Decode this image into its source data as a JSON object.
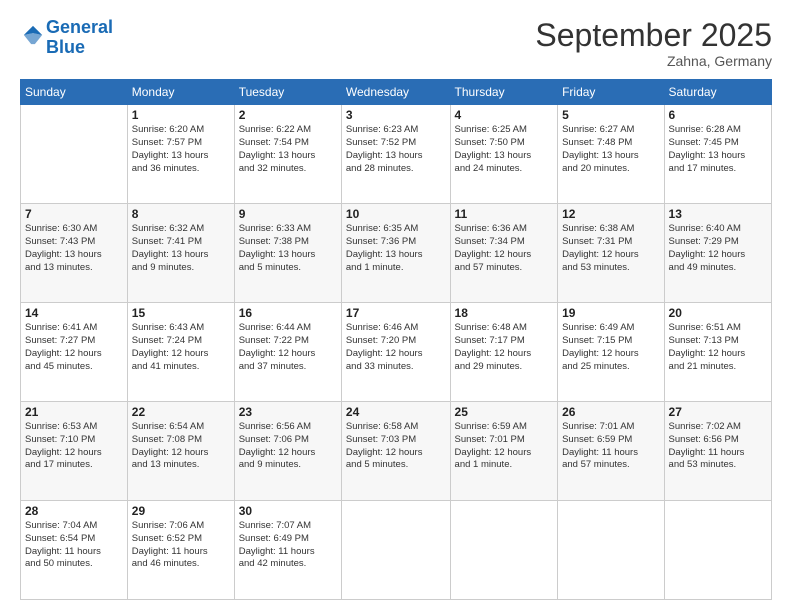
{
  "header": {
    "logo_line1": "General",
    "logo_line2": "Blue",
    "month": "September 2025",
    "location": "Zahna, Germany"
  },
  "days_of_week": [
    "Sunday",
    "Monday",
    "Tuesday",
    "Wednesday",
    "Thursday",
    "Friday",
    "Saturday"
  ],
  "weeks": [
    [
      {
        "day": "",
        "info": ""
      },
      {
        "day": "1",
        "info": "Sunrise: 6:20 AM\nSunset: 7:57 PM\nDaylight: 13 hours\nand 36 minutes."
      },
      {
        "day": "2",
        "info": "Sunrise: 6:22 AM\nSunset: 7:54 PM\nDaylight: 13 hours\nand 32 minutes."
      },
      {
        "day": "3",
        "info": "Sunrise: 6:23 AM\nSunset: 7:52 PM\nDaylight: 13 hours\nand 28 minutes."
      },
      {
        "day": "4",
        "info": "Sunrise: 6:25 AM\nSunset: 7:50 PM\nDaylight: 13 hours\nand 24 minutes."
      },
      {
        "day": "5",
        "info": "Sunrise: 6:27 AM\nSunset: 7:48 PM\nDaylight: 13 hours\nand 20 minutes."
      },
      {
        "day": "6",
        "info": "Sunrise: 6:28 AM\nSunset: 7:45 PM\nDaylight: 13 hours\nand 17 minutes."
      }
    ],
    [
      {
        "day": "7",
        "info": "Sunrise: 6:30 AM\nSunset: 7:43 PM\nDaylight: 13 hours\nand 13 minutes."
      },
      {
        "day": "8",
        "info": "Sunrise: 6:32 AM\nSunset: 7:41 PM\nDaylight: 13 hours\nand 9 minutes."
      },
      {
        "day": "9",
        "info": "Sunrise: 6:33 AM\nSunset: 7:38 PM\nDaylight: 13 hours\nand 5 minutes."
      },
      {
        "day": "10",
        "info": "Sunrise: 6:35 AM\nSunset: 7:36 PM\nDaylight: 13 hours\nand 1 minute."
      },
      {
        "day": "11",
        "info": "Sunrise: 6:36 AM\nSunset: 7:34 PM\nDaylight: 12 hours\nand 57 minutes."
      },
      {
        "day": "12",
        "info": "Sunrise: 6:38 AM\nSunset: 7:31 PM\nDaylight: 12 hours\nand 53 minutes."
      },
      {
        "day": "13",
        "info": "Sunrise: 6:40 AM\nSunset: 7:29 PM\nDaylight: 12 hours\nand 49 minutes."
      }
    ],
    [
      {
        "day": "14",
        "info": "Sunrise: 6:41 AM\nSunset: 7:27 PM\nDaylight: 12 hours\nand 45 minutes."
      },
      {
        "day": "15",
        "info": "Sunrise: 6:43 AM\nSunset: 7:24 PM\nDaylight: 12 hours\nand 41 minutes."
      },
      {
        "day": "16",
        "info": "Sunrise: 6:44 AM\nSunset: 7:22 PM\nDaylight: 12 hours\nand 37 minutes."
      },
      {
        "day": "17",
        "info": "Sunrise: 6:46 AM\nSunset: 7:20 PM\nDaylight: 12 hours\nand 33 minutes."
      },
      {
        "day": "18",
        "info": "Sunrise: 6:48 AM\nSunset: 7:17 PM\nDaylight: 12 hours\nand 29 minutes."
      },
      {
        "day": "19",
        "info": "Sunrise: 6:49 AM\nSunset: 7:15 PM\nDaylight: 12 hours\nand 25 minutes."
      },
      {
        "day": "20",
        "info": "Sunrise: 6:51 AM\nSunset: 7:13 PM\nDaylight: 12 hours\nand 21 minutes."
      }
    ],
    [
      {
        "day": "21",
        "info": "Sunrise: 6:53 AM\nSunset: 7:10 PM\nDaylight: 12 hours\nand 17 minutes."
      },
      {
        "day": "22",
        "info": "Sunrise: 6:54 AM\nSunset: 7:08 PM\nDaylight: 12 hours\nand 13 minutes."
      },
      {
        "day": "23",
        "info": "Sunrise: 6:56 AM\nSunset: 7:06 PM\nDaylight: 12 hours\nand 9 minutes."
      },
      {
        "day": "24",
        "info": "Sunrise: 6:58 AM\nSunset: 7:03 PM\nDaylight: 12 hours\nand 5 minutes."
      },
      {
        "day": "25",
        "info": "Sunrise: 6:59 AM\nSunset: 7:01 PM\nDaylight: 12 hours\nand 1 minute."
      },
      {
        "day": "26",
        "info": "Sunrise: 7:01 AM\nSunset: 6:59 PM\nDaylight: 11 hours\nand 57 minutes."
      },
      {
        "day": "27",
        "info": "Sunrise: 7:02 AM\nSunset: 6:56 PM\nDaylight: 11 hours\nand 53 minutes."
      }
    ],
    [
      {
        "day": "28",
        "info": "Sunrise: 7:04 AM\nSunset: 6:54 PM\nDaylight: 11 hours\nand 50 minutes."
      },
      {
        "day": "29",
        "info": "Sunrise: 7:06 AM\nSunset: 6:52 PM\nDaylight: 11 hours\nand 46 minutes."
      },
      {
        "day": "30",
        "info": "Sunrise: 7:07 AM\nSunset: 6:49 PM\nDaylight: 11 hours\nand 42 minutes."
      },
      {
        "day": "",
        "info": ""
      },
      {
        "day": "",
        "info": ""
      },
      {
        "day": "",
        "info": ""
      },
      {
        "day": "",
        "info": ""
      }
    ]
  ]
}
